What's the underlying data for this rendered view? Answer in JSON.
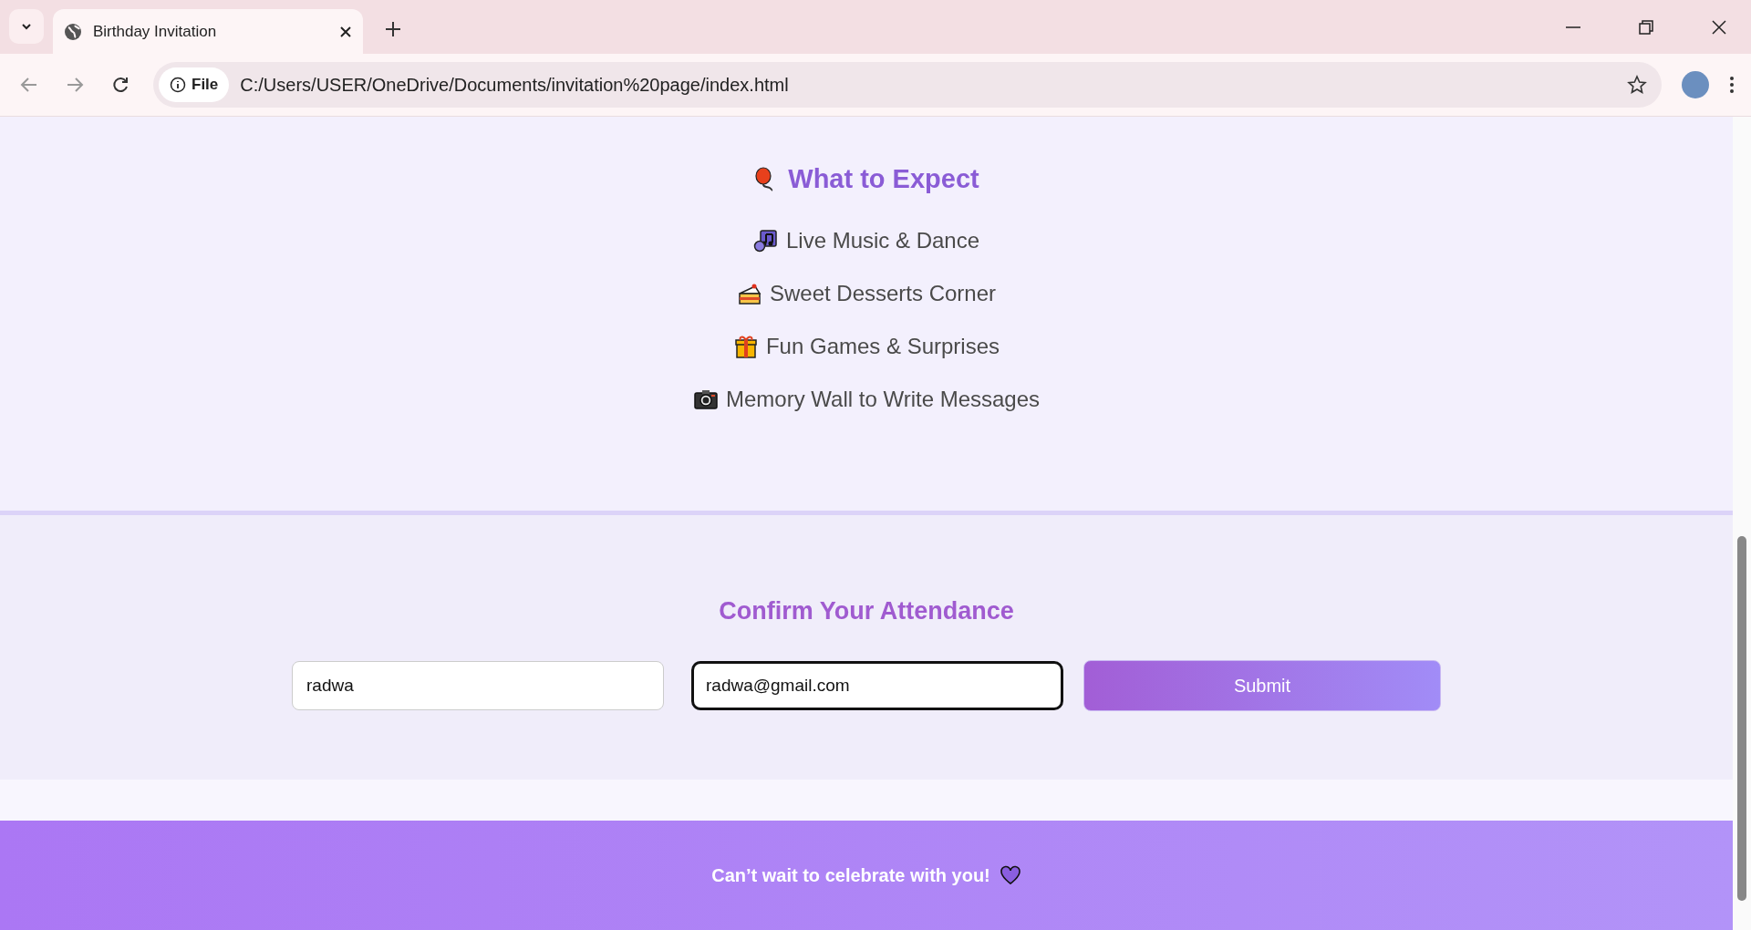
{
  "browser": {
    "tab_title": "Birthday Invitation",
    "address_badge": "File",
    "url": "C:/Users/USER/OneDrive/Documents/invitation%20page/index.html"
  },
  "expect": {
    "title": "What to Expect",
    "items": [
      {
        "kind": "music",
        "text": "Live Music & Dance"
      },
      {
        "kind": "cake",
        "text": "Sweet Desserts Corner"
      },
      {
        "kind": "gift",
        "text": "Fun Games & Surprises"
      },
      {
        "kind": "camera",
        "text": "Memory Wall to Write Messages"
      }
    ]
  },
  "rsvp": {
    "title": "Confirm Your Attendance",
    "fields": [
      {
        "value": "radwa",
        "focused": false
      },
      {
        "value": "radwa@gmail.com",
        "focused": true
      }
    ],
    "submit": "Submit"
  },
  "footer": {
    "text": "Can’t wait to celebrate with you!"
  }
}
